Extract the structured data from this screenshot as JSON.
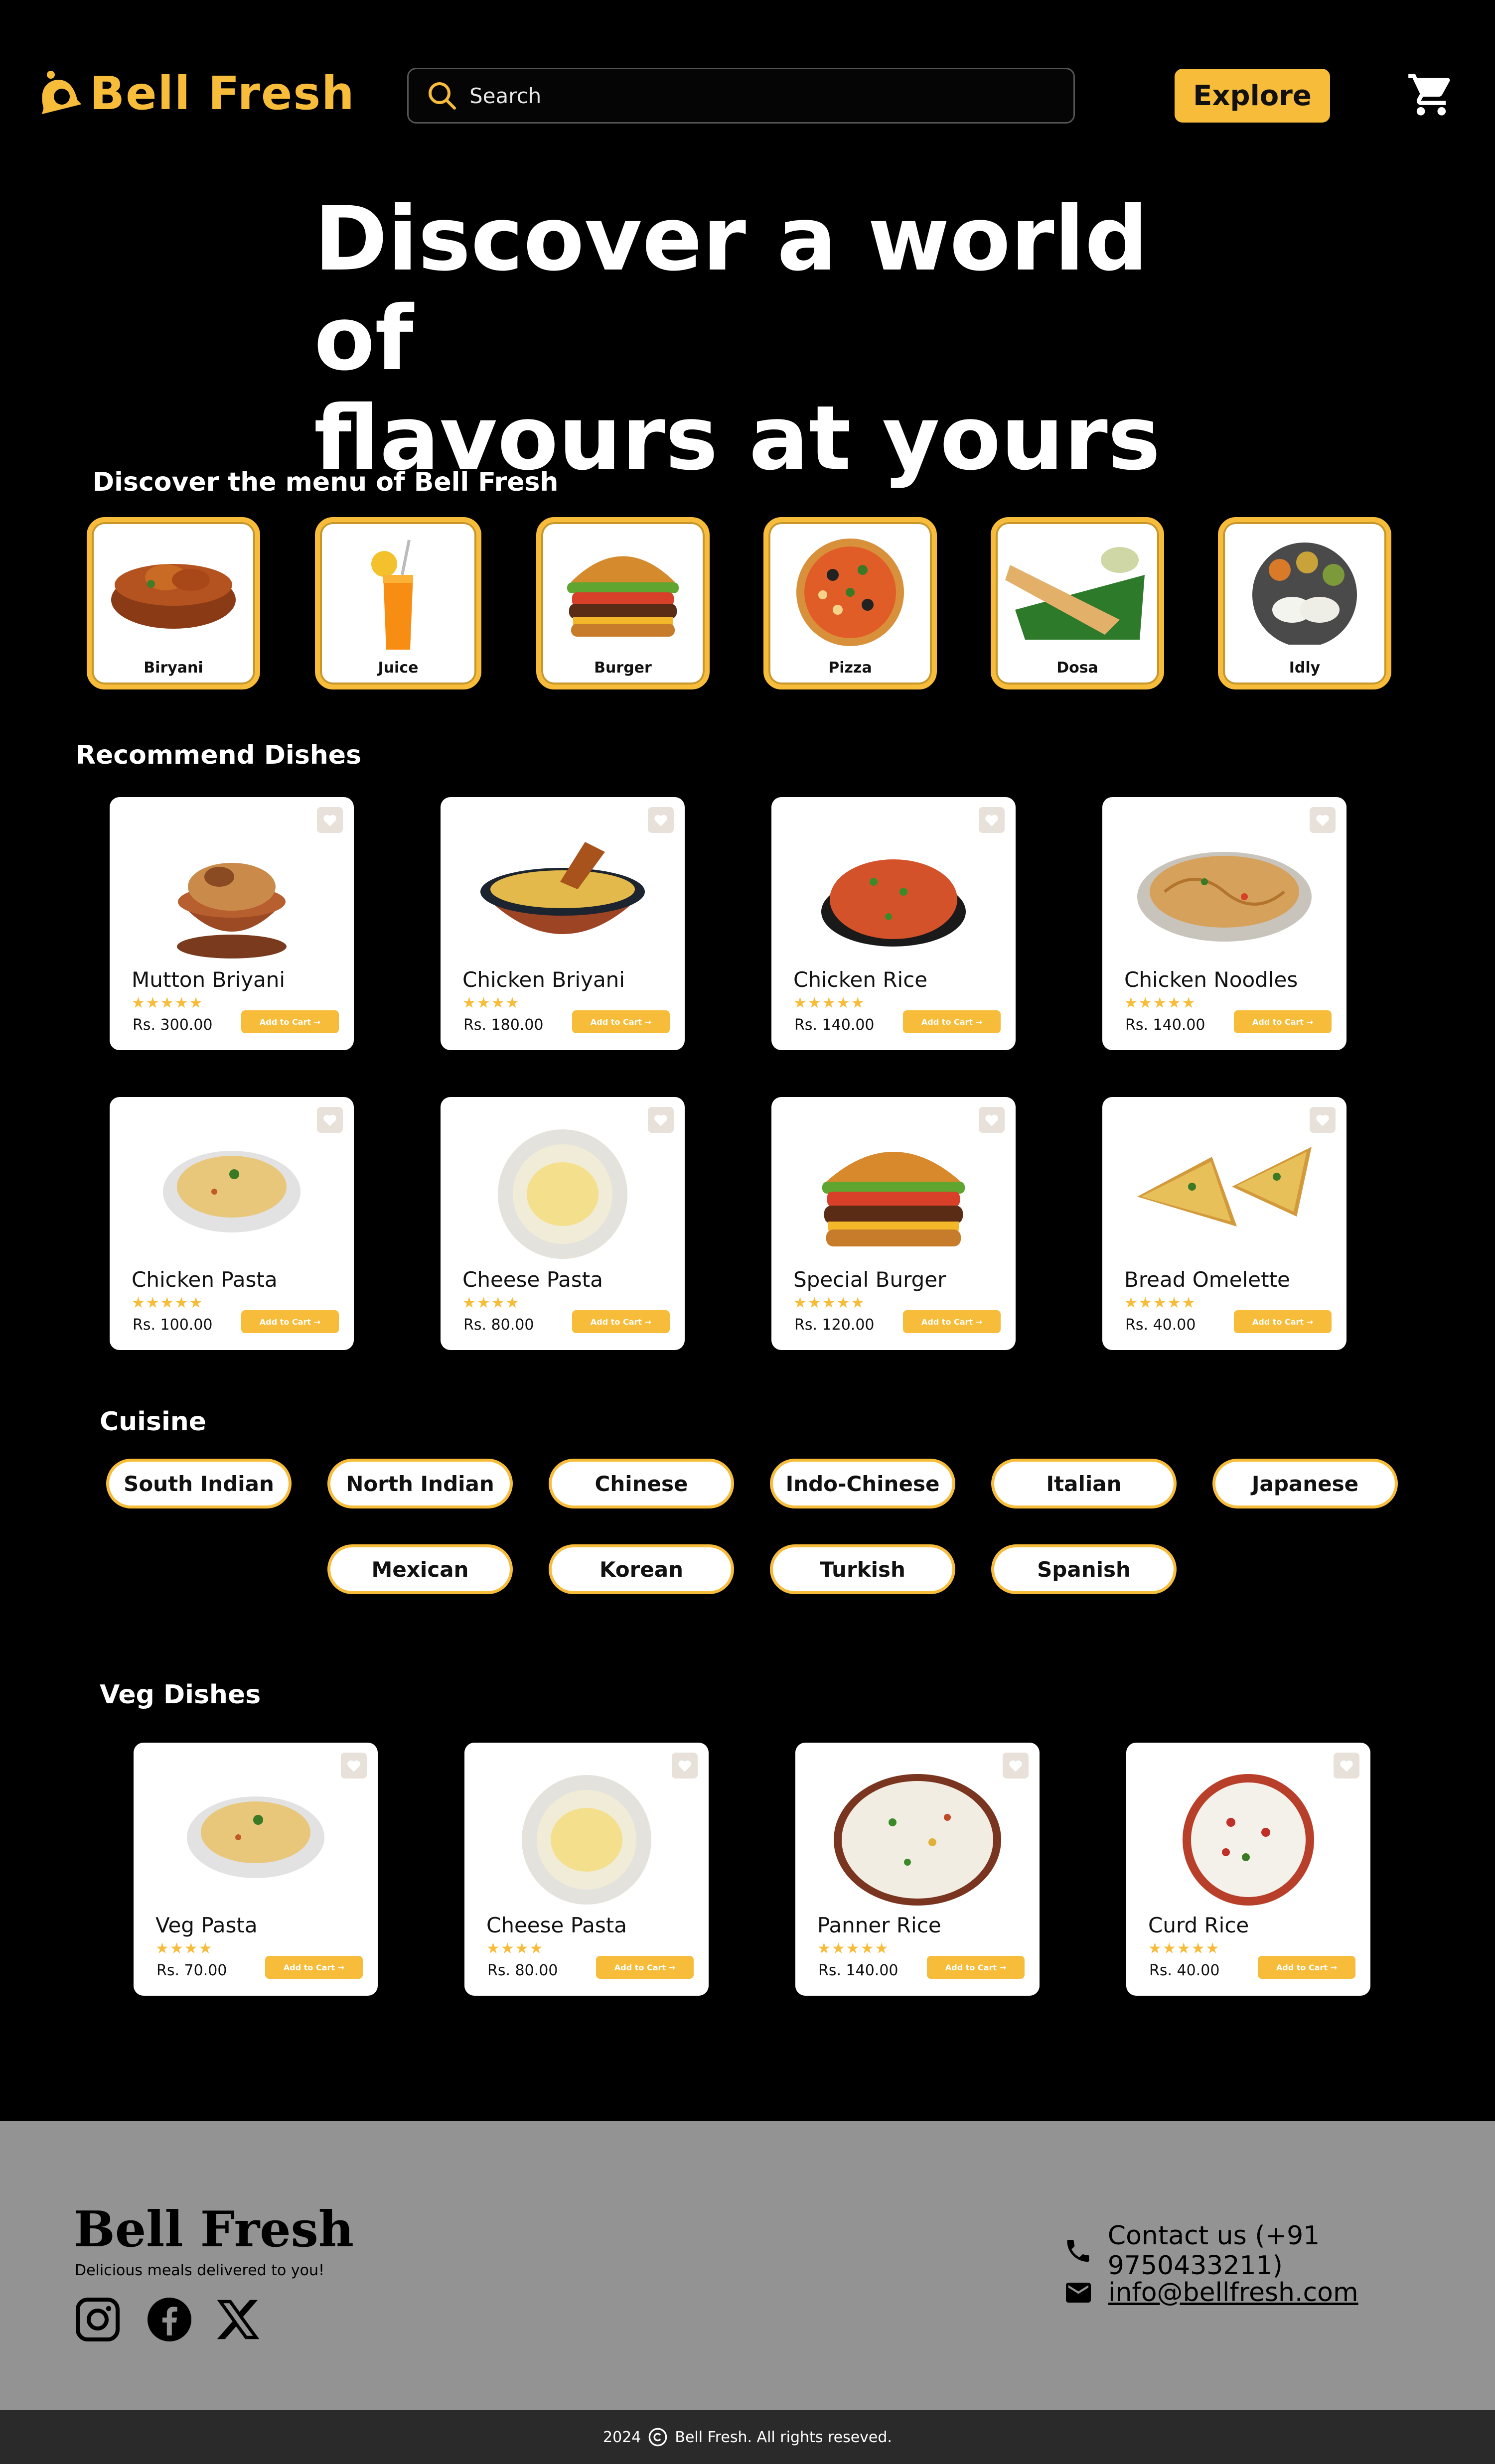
{
  "brand": {
    "name": "Bell Fresh",
    "accent": "#f7bd3a"
  },
  "nav": {
    "search_placeholder": "Search",
    "explore_label": "Explore",
    "cart_icon": "cart-icon"
  },
  "hero": {
    "line1": "Discover a world of",
    "line2": "flavours at yours"
  },
  "menu": {
    "title": "Discover the menu of Bell Fresh",
    "categories": [
      "Biryani",
      "Juice",
      "Burger",
      "Pizza",
      "Dosa",
      "Idly"
    ]
  },
  "recommended": {
    "title": "Recommend Dishes",
    "cart_label": "Add to Cart",
    "dishes": [
      {
        "name": "Mutton Briyani",
        "price": "Rs. 300.00",
        "rating": 5
      },
      {
        "name": "Chicken Briyani",
        "price": "Rs. 180.00",
        "rating": 4
      },
      {
        "name": "Chicken Rice",
        "price": "Rs. 140.00",
        "rating": 5
      },
      {
        "name": "Chicken Noodles",
        "price": "Rs. 140.00",
        "rating": 5
      },
      {
        "name": "Chicken Pasta",
        "price": "Rs. 100.00",
        "rating": 5
      },
      {
        "name": "Cheese Pasta",
        "price": "Rs. 80.00",
        "rating": 4
      },
      {
        "name": "Special Burger",
        "price": "Rs. 120.00",
        "rating": 5
      },
      {
        "name": "Bread Omelette",
        "price": "Rs. 40.00",
        "rating": 5
      }
    ]
  },
  "cuisine": {
    "title": "Cuisine",
    "items": [
      "South Indian",
      "North Indian",
      "Chinese",
      "Indo-Chinese",
      "Italian",
      "Japanese",
      "Mexican",
      "Korean",
      "Turkish",
      "Spanish"
    ]
  },
  "veg": {
    "title": "Veg Dishes",
    "dishes": [
      {
        "name": "Veg Pasta",
        "price": "Rs. 70.00",
        "rating": 4
      },
      {
        "name": "Cheese Pasta",
        "price": "Rs. 80.00",
        "rating": 4
      },
      {
        "name": "Panner Rice",
        "price": "Rs. 140.00",
        "rating": 5
      },
      {
        "name": "Curd Rice",
        "price": "Rs. 40.00",
        "rating": 5
      }
    ]
  },
  "footer": {
    "brand": "Bell Fresh",
    "tagline": "Delicious meals delivered to you!",
    "contact_phone": "Contact us (+91 9750433211)",
    "email": "info@bellfresh.com",
    "copyright_year": "2024",
    "copyright_text": "Bell Fresh. All rights reseved."
  }
}
